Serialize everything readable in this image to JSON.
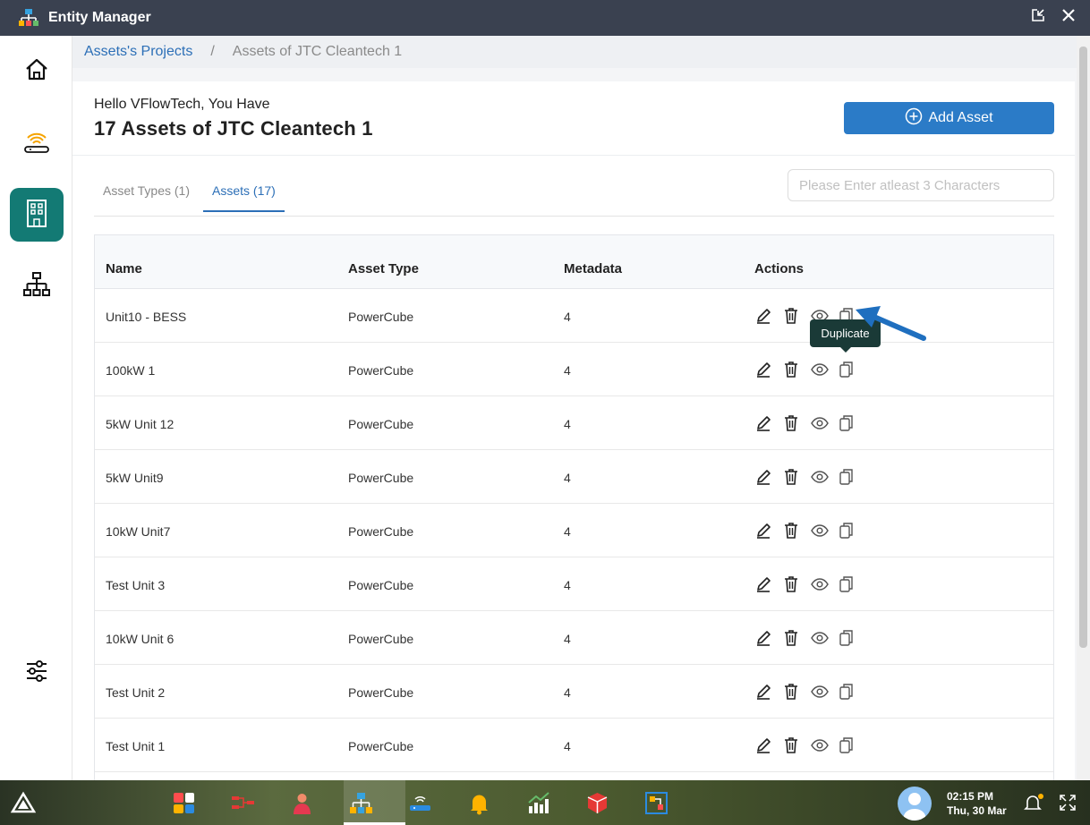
{
  "window": {
    "title": "Entity Manager"
  },
  "breadcrumb": {
    "parent": "Assets's Projects",
    "separator": "/",
    "current": "Assets of JTC Cleantech 1"
  },
  "header": {
    "greeting": "Hello VFlowTech, You Have",
    "title": "17 Assets of JTC Cleantech 1",
    "add_button": "Add Asset"
  },
  "tabs": [
    {
      "label": "Asset Types (1)",
      "active": false
    },
    {
      "label": "Assets (17)",
      "active": true
    }
  ],
  "search": {
    "placeholder": "Please Enter atleast 3 Characters",
    "value": ""
  },
  "table": {
    "columns": [
      "Name",
      "Asset Type",
      "Metadata",
      "Actions"
    ],
    "rows": [
      {
        "name": "Unit10 - BESS",
        "type": "PowerCube",
        "metadata": "4"
      },
      {
        "name": "100kW 1",
        "type": "PowerCube",
        "metadata": "4"
      },
      {
        "name": "5kW Unit 12",
        "type": "PowerCube",
        "metadata": "4"
      },
      {
        "name": "5kW Unit9",
        "type": "PowerCube",
        "metadata": "4"
      },
      {
        "name": "10kW Unit7",
        "type": "PowerCube",
        "metadata": "4"
      },
      {
        "name": "Test Unit 3",
        "type": "PowerCube",
        "metadata": "4"
      },
      {
        "name": "10kW Unit 6",
        "type": "PowerCube",
        "metadata": "4"
      },
      {
        "name": "Test Unit 2",
        "type": "PowerCube",
        "metadata": "4"
      },
      {
        "name": "Test Unit 1",
        "type": "PowerCube",
        "metadata": "4"
      }
    ],
    "action_icons": [
      "edit-icon",
      "delete-icon",
      "view-icon",
      "duplicate-icon"
    ]
  },
  "tooltip": {
    "text": "Duplicate"
  },
  "sidebar": {
    "items": [
      "home-icon",
      "router-icon",
      "building-icon",
      "hierarchy-icon"
    ],
    "bottom": "settings-sliders-icon",
    "active": "building-icon"
  },
  "taskbar": {
    "time": "02:15 PM",
    "date": "Thu, 30 Mar"
  },
  "colors": {
    "accent": "#2b7bc7",
    "active_nav": "#137a74",
    "titlebar": "#3a4150",
    "tooltip": "#1a3a37"
  }
}
